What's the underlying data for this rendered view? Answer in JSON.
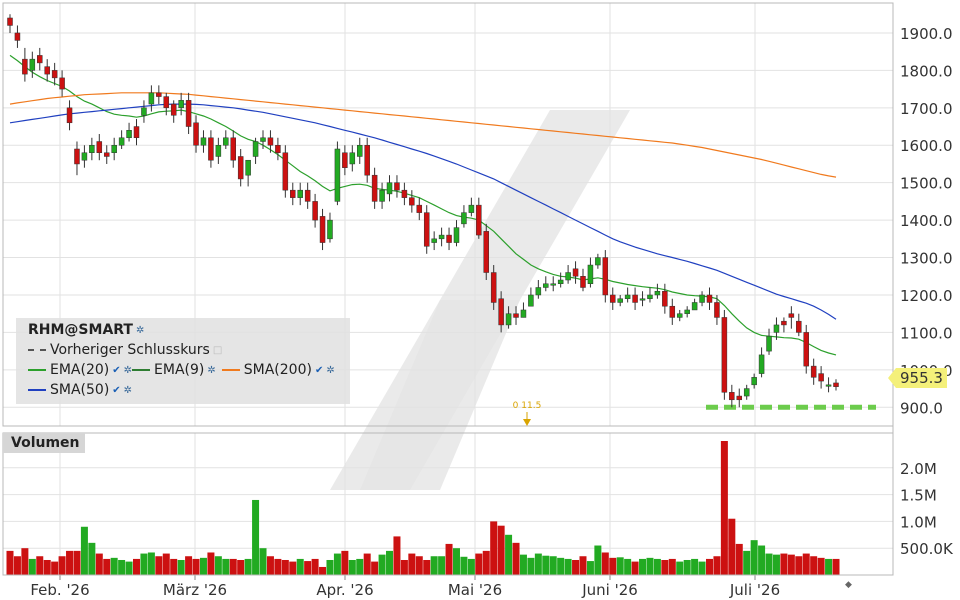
{
  "chart_data": [
    {
      "type": "candlestick",
      "title": "RHM@SMART",
      "ylim": [
        850,
        1980
      ],
      "y_ticks": [
        900,
        1000,
        1100,
        1200,
        1300,
        1400,
        1500,
        1600,
        1700,
        1800,
        1900
      ],
      "y_tick_labels": [
        "900.0",
        "1000.0",
        "1100.0",
        "1200.0",
        "1300.0",
        "1400.0",
        "1500.0",
        "1600.0",
        "1700.0",
        "1800.0",
        "1900.0"
      ],
      "x_labels": [
        "Feb. '26",
        "März '26",
        "Apr. '26",
        "Mai '26",
        "Juni '26",
        "Juli '26"
      ],
      "last_price_label": "955.3",
      "annotation": "0 11.5",
      "close": [
        1920,
        1880,
        1790,
        1830,
        1820,
        1790,
        1780,
        1750,
        1660,
        1550,
        1580,
        1600,
        1580,
        1570,
        1600,
        1620,
        1640,
        1620,
        1700,
        1740,
        1730,
        1700,
        1680,
        1720,
        1650,
        1600,
        1620,
        1560,
        1600,
        1620,
        1560,
        1510,
        1560,
        1610,
        1620,
        1600,
        1580,
        1480,
        1460,
        1480,
        1450,
        1400,
        1340,
        1400,
        1590,
        1540,
        1580,
        1600,
        1520,
        1450,
        1480,
        1500,
        1480,
        1460,
        1440,
        1420,
        1330,
        1350,
        1360,
        1340,
        1380,
        1420,
        1440,
        1360,
        1260,
        1180,
        1120,
        1150,
        1140,
        1160,
        1200,
        1220,
        1230,
        1230,
        1240,
        1260,
        1250,
        1220,
        1280,
        1300,
        1200,
        1180,
        1190,
        1200,
        1180,
        1190,
        1200,
        1210,
        1170,
        1140,
        1150,
        1160,
        1180,
        1200,
        1180,
        1140,
        940,
        920,
        920,
        950,
        980,
        1040,
        1090,
        1120,
        1120,
        1140,
        1100,
        1010,
        980,
        970,
        960,
        955
      ],
      "open": [
        1940,
        1900,
        1830,
        1800,
        1840,
        1810,
        1800,
        1780,
        1700,
        1590,
        1560,
        1580,
        1610,
        1580,
        1580,
        1600,
        1620,
        1650,
        1680,
        1710,
        1740,
        1730,
        1710,
        1700,
        1720,
        1660,
        1600,
        1620,
        1570,
        1600,
        1620,
        1570,
        1520,
        1570,
        1610,
        1620,
        1600,
        1580,
        1480,
        1460,
        1480,
        1450,
        1410,
        1350,
        1450,
        1580,
        1550,
        1570,
        1600,
        1520,
        1450,
        1470,
        1500,
        1480,
        1460,
        1440,
        1420,
        1340,
        1350,
        1360,
        1340,
        1390,
        1420,
        1440,
        1370,
        1260,
        1190,
        1120,
        1150,
        1140,
        1170,
        1200,
        1220,
        1230,
        1230,
        1240,
        1270,
        1250,
        1230,
        1280,
        1300,
        1200,
        1180,
        1190,
        1200,
        1190,
        1190,
        1200,
        1210,
        1170,
        1140,
        1150,
        1160,
        1180,
        1200,
        1180,
        1140,
        940,
        930,
        930,
        960,
        990,
        1050,
        1100,
        1130,
        1150,
        1130,
        1100,
        1010,
        990,
        960,
        965
      ],
      "high": [
        1950,
        1920,
        1860,
        1850,
        1860,
        1830,
        1820,
        1800,
        1720,
        1610,
        1600,
        1620,
        1630,
        1600,
        1620,
        1640,
        1660,
        1670,
        1720,
        1760,
        1760,
        1740,
        1720,
        1740,
        1740,
        1680,
        1640,
        1640,
        1620,
        1640,
        1640,
        1590,
        1540,
        1620,
        1640,
        1640,
        1620,
        1600,
        1500,
        1500,
        1500,
        1470,
        1430,
        1420,
        1610,
        1600,
        1600,
        1620,
        1620,
        1540,
        1500,
        1520,
        1520,
        1500,
        1480,
        1460,
        1440,
        1370,
        1380,
        1380,
        1400,
        1440,
        1460,
        1460,
        1390,
        1280,
        1210,
        1170,
        1170,
        1180,
        1220,
        1240,
        1250,
        1250,
        1260,
        1280,
        1290,
        1270,
        1300,
        1310,
        1320,
        1220,
        1200,
        1220,
        1220,
        1210,
        1220,
        1230,
        1230,
        1190,
        1160,
        1170,
        1190,
        1210,
        1220,
        1200,
        1160,
        960,
        950,
        960,
        990,
        1060,
        1110,
        1140,
        1140,
        1170,
        1150,
        1120,
        1030,
        1010,
        980,
        975
      ],
      "low": [
        1900,
        1860,
        1770,
        1780,
        1800,
        1770,
        1760,
        1730,
        1640,
        1520,
        1540,
        1560,
        1560,
        1550,
        1560,
        1590,
        1610,
        1600,
        1660,
        1690,
        1710,
        1680,
        1660,
        1680,
        1630,
        1580,
        1580,
        1540,
        1550,
        1590,
        1540,
        1490,
        1490,
        1550,
        1590,
        1580,
        1560,
        1460,
        1440,
        1440,
        1430,
        1380,
        1320,
        1340,
        1440,
        1520,
        1530,
        1550,
        1500,
        1430,
        1430,
        1450,
        1460,
        1440,
        1420,
        1400,
        1310,
        1320,
        1330,
        1320,
        1330,
        1380,
        1410,
        1350,
        1240,
        1160,
        1100,
        1110,
        1120,
        1140,
        1180,
        1190,
        1210,
        1210,
        1220,
        1230,
        1230,
        1210,
        1220,
        1270,
        1180,
        1160,
        1170,
        1180,
        1160,
        1170,
        1180,
        1190,
        1150,
        1120,
        1130,
        1140,
        1160,
        1170,
        1160,
        1120,
        920,
        900,
        900,
        920,
        950,
        980,
        1040,
        1080,
        1100,
        1110,
        1090,
        990,
        960,
        950,
        940,
        945
      ],
      "series": [
        {
          "name": "EMA(20)",
          "color": "#2ca02c",
          "values": [
            1840,
            1826,
            1810,
            1795,
            1783,
            1773,
            1765,
            1757,
            1745,
            1730,
            1718,
            1710,
            1700,
            1690,
            1683,
            1680,
            1678,
            1675,
            1678,
            1684,
            1689,
            1691,
            1692,
            1694,
            1690,
            1684,
            1678,
            1670,
            1660,
            1650,
            1638,
            1625,
            1616,
            1610,
            1600,
            1588,
            1575,
            1560,
            1545,
            1530,
            1518,
            1505,
            1490,
            1478,
            1485,
            1490,
            1495,
            1496,
            1493,
            1485,
            1482,
            1480,
            1477,
            1472,
            1466,
            1460,
            1450,
            1440,
            1430,
            1420,
            1412,
            1408,
            1405,
            1400,
            1385,
            1370,
            1350,
            1330,
            1310,
            1295,
            1280,
            1270,
            1262,
            1255,
            1250,
            1248,
            1245,
            1240,
            1243,
            1246,
            1242,
            1236,
            1232,
            1228,
            1225,
            1222,
            1220,
            1218,
            1214,
            1208,
            1204,
            1200,
            1198,
            1197,
            1195,
            1190,
            1172,
            1150,
            1130,
            1112,
            1100,
            1092,
            1090,
            1088,
            1086,
            1085,
            1082,
            1073,
            1062,
            1052,
            1045,
            1040
          ]
        },
        {
          "name": "EMA(9)",
          "color": "#2e7d32",
          "values": []
        },
        {
          "name": "SMA(200)",
          "color": "#f07a1e",
          "values": [
            1710,
            1713,
            1716,
            1719,
            1722,
            1725,
            1727,
            1729,
            1731,
            1733,
            1735,
            1736,
            1737,
            1738,
            1739,
            1740,
            1740,
            1740,
            1740,
            1740,
            1740,
            1739,
            1738,
            1737,
            1736,
            1734,
            1732,
            1730,
            1728,
            1726,
            1724,
            1722,
            1720,
            1718,
            1716,
            1714,
            1712,
            1710,
            1708,
            1706,
            1704,
            1702,
            1700,
            1698,
            1696,
            1694,
            1692,
            1690,
            1688,
            1686,
            1684,
            1682,
            1680,
            1678,
            1676,
            1674,
            1672,
            1670,
            1668,
            1666,
            1664,
            1662,
            1660,
            1658,
            1656,
            1654,
            1652,
            1650,
            1648,
            1646,
            1644,
            1642,
            1640,
            1638,
            1636,
            1634,
            1632,
            1630,
            1628,
            1626,
            1624,
            1622,
            1620,
            1618,
            1616,
            1614,
            1612,
            1610,
            1608,
            1606,
            1603,
            1600,
            1597,
            1594,
            1590,
            1586,
            1582,
            1578,
            1574,
            1570,
            1566,
            1562,
            1557,
            1552,
            1547,
            1542,
            1537,
            1532,
            1527,
            1522,
            1518,
            1515
          ]
        },
        {
          "name": "SMA(50)",
          "color": "#2040c0",
          "values": [
            1660,
            1663,
            1666,
            1669,
            1672,
            1675,
            1678,
            1681,
            1684,
            1686,
            1688,
            1690,
            1692,
            1694,
            1696,
            1698,
            1700,
            1702,
            1704,
            1706,
            1708,
            1709,
            1710,
            1710,
            1710,
            1709,
            1708,
            1706,
            1704,
            1702,
            1700,
            1697,
            1694,
            1691,
            1688,
            1684,
            1680,
            1676,
            1672,
            1668,
            1664,
            1660,
            1655,
            1650,
            1645,
            1640,
            1635,
            1630,
            1625,
            1620,
            1614,
            1608,
            1602,
            1596,
            1590,
            1584,
            1578,
            1571,
            1564,
            1557,
            1550,
            1542,
            1534,
            1526,
            1518,
            1510,
            1500,
            1490,
            1480,
            1470,
            1460,
            1450,
            1440,
            1430,
            1420,
            1410,
            1400,
            1390,
            1380,
            1370,
            1360,
            1350,
            1342,
            1335,
            1328,
            1322,
            1316,
            1310,
            1305,
            1300,
            1295,
            1290,
            1284,
            1278,
            1272,
            1266,
            1258,
            1250,
            1242,
            1234,
            1226,
            1218,
            1210,
            1202,
            1196,
            1190,
            1184,
            1178,
            1170,
            1160,
            1148,
            1135
          ]
        }
      ],
      "support_level": 900
    },
    {
      "type": "bar",
      "title": "Volumen",
      "ylim": [
        0,
        2500000
      ],
      "y_ticks": [
        500000,
        1000000,
        1500000,
        2000000
      ],
      "y_tick_labels": [
        "500.0K",
        "1.0M",
        "1.5M",
        "2.0M"
      ],
      "values": [
        450000,
        350000,
        500000,
        300000,
        350000,
        280000,
        250000,
        350000,
        450000,
        450000,
        900000,
        600000,
        400000,
        300000,
        320000,
        280000,
        250000,
        300000,
        400000,
        420000,
        350000,
        400000,
        300000,
        280000,
        350000,
        300000,
        320000,
        420000,
        350000,
        300000,
        300000,
        280000,
        300000,
        1400000,
        500000,
        350000,
        300000,
        280000,
        250000,
        300000,
        260000,
        300000,
        150000,
        280000,
        400000,
        450000,
        280000,
        300000,
        400000,
        250000,
        380000,
        450000,
        720000,
        280000,
        400000,
        350000,
        280000,
        350000,
        350000,
        580000,
        500000,
        340000,
        300000,
        400000,
        450000,
        1000000,
        920000,
        750000,
        600000,
        380000,
        320000,
        400000,
        360000,
        350000,
        320000,
        300000,
        280000,
        350000,
        260000,
        550000,
        420000,
        320000,
        330000,
        300000,
        250000,
        300000,
        320000,
        300000,
        280000,
        300000,
        250000,
        280000,
        300000,
        250000,
        300000,
        350000,
        2500000,
        1050000,
        580000,
        450000,
        650000,
        550000,
        400000,
        380000,
        400000,
        380000,
        350000,
        400000,
        350000,
        320000,
        300000,
        300000
      ],
      "up_color": "#22aa22",
      "down_color": "#cc1111"
    }
  ],
  "legend": {
    "title": "RHM@SMART",
    "prev_close": "Vorheriger Schlusskurs",
    "ema20": "EMA(20)",
    "ema9": "EMA(9)",
    "sma200": "SMA(200)",
    "sma50": "SMA(50)"
  },
  "volume_label": "Volumen",
  "price_tag": "955.3",
  "watermark_color": "#e5e5e5"
}
